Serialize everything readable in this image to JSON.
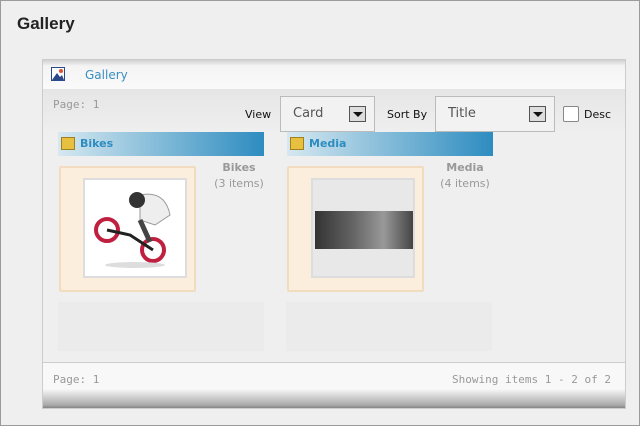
{
  "page_title": "Gallery",
  "panel": {
    "header_title": "Gallery",
    "page_label": "Page: 1",
    "view_label": "View",
    "view_value": "Card",
    "sort_label": "Sort By",
    "sort_value": "Title",
    "desc_label": "Desc",
    "desc_checked": false
  },
  "albums": [
    {
      "name": "Bikes",
      "count": "(3 items)"
    },
    {
      "name": "Media",
      "count": "(4 items)"
    }
  ],
  "footer": {
    "page_label": "Page: 1",
    "showing": "Showing items 1 - 2 of 2"
  }
}
